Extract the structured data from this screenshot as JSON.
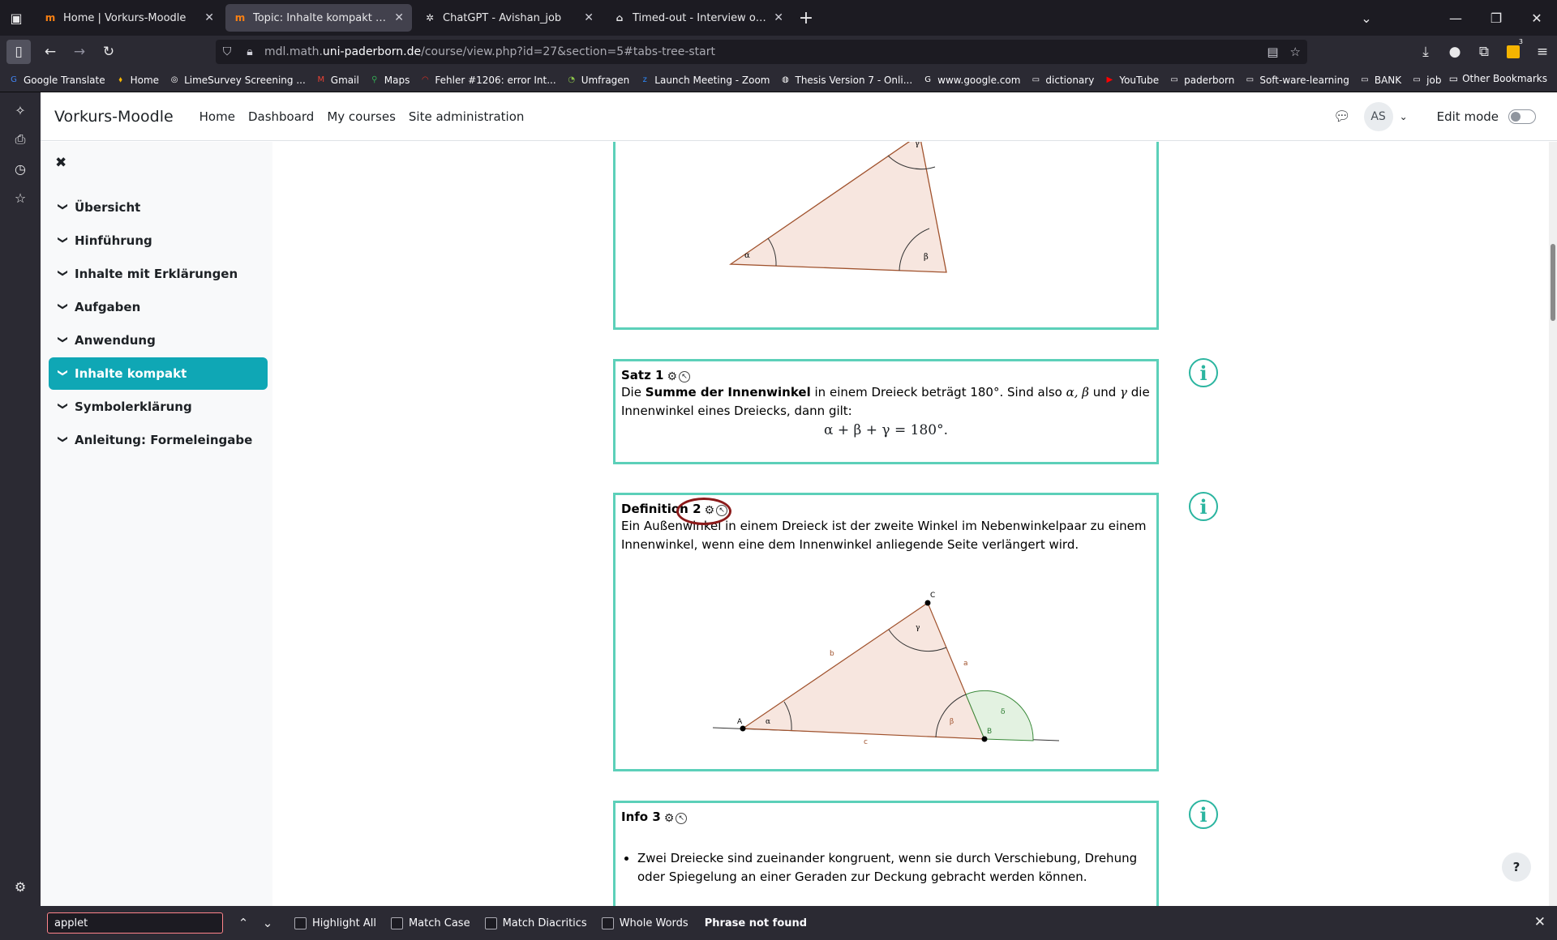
{
  "browser": {
    "tabs": [
      {
        "title": "Home | Vorkurs-Moodle",
        "favicon": "moodle-icon",
        "favicon_text": "m",
        "active": false
      },
      {
        "title": "Topic: Inhalte kompakt | Dreieck",
        "favicon": "moodle-icon",
        "favicon_text": "m",
        "active": true
      },
      {
        "title": "ChatGPT - Avishan_job",
        "favicon": "chatgpt-icon",
        "favicon_text": "✲",
        "active": false
      },
      {
        "title": "Timed-out - Interview on Passw",
        "favicon": "limesurvey-icon",
        "favicon_text": "⌂",
        "active": false
      }
    ],
    "url_prefix": "mdl.math.",
    "url_domain": "uni-paderborn.de",
    "url_path": "/course/view.php?id=27&section=5#tabs-tree-start",
    "bookmarks": [
      {
        "label": "Google Translate",
        "icon": "google-translate-icon",
        "glyph": "G",
        "color": "#4285f4"
      },
      {
        "label": "Home",
        "icon": "home-icon",
        "glyph": "⬧",
        "color": "#f5b400"
      },
      {
        "label": "LimeSurvey Screening ...",
        "icon": "limesurvey-icon",
        "glyph": "◎",
        "color": "#ffffff"
      },
      {
        "label": "Gmail",
        "icon": "gmail-icon",
        "glyph": "M",
        "color": "#ea4335"
      },
      {
        "label": "Maps",
        "icon": "maps-icon",
        "glyph": "⚲",
        "color": "#34a853"
      },
      {
        "label": "Fehler #1206: error Int...",
        "icon": "error-icon",
        "glyph": "◠",
        "color": "#d93025"
      },
      {
        "label": "Umfragen",
        "icon": "survey-icon",
        "glyph": "◔",
        "color": "#8bc34a"
      },
      {
        "label": "Launch Meeting - Zoom",
        "icon": "zoom-icon",
        "glyph": "z",
        "color": "#2d8cff"
      },
      {
        "label": "Thesis Version 7 - Onli...",
        "icon": "overleaf-icon",
        "glyph": "◍",
        "color": "#ffffff"
      },
      {
        "label": "www.google.com",
        "icon": "google-icon",
        "glyph": "G",
        "color": "#ffffff"
      },
      {
        "label": "dictionary",
        "icon": "folder-icon",
        "glyph": "▭",
        "color": "#fbfbfe"
      },
      {
        "label": "YouTube",
        "icon": "youtube-icon",
        "glyph": "▶",
        "color": "#ff0000"
      },
      {
        "label": "paderborn",
        "icon": "folder-icon",
        "glyph": "▭",
        "color": "#fbfbfe"
      },
      {
        "label": "Soft-ware-learning",
        "icon": "folder-icon",
        "glyph": "▭",
        "color": "#fbfbfe"
      },
      {
        "label": "BANK",
        "icon": "folder-icon",
        "glyph": "▭",
        "color": "#fbfbfe"
      },
      {
        "label": "job",
        "icon": "folder-icon",
        "glyph": "▭",
        "color": "#fbfbfe"
      }
    ],
    "other_bookmarks": "Other Bookmarks",
    "extension_badge": "3"
  },
  "moodle": {
    "site_name": "Vorkurs-Moodle",
    "nav": [
      "Home",
      "Dashboard",
      "My courses",
      "Site administration"
    ],
    "user_initials": "AS",
    "edit_mode_label": "Edit mode",
    "course_index": [
      {
        "label": "Übersicht",
        "active": false
      },
      {
        "label": "Hinführung",
        "active": false
      },
      {
        "label": "Inhalte mit Erklärungen",
        "active": false
      },
      {
        "label": "Aufgaben",
        "active": false
      },
      {
        "label": "Anwendung",
        "active": false
      },
      {
        "label": "Inhalte kompakt",
        "active": true
      },
      {
        "label": "Symbolerklärung",
        "active": false
      },
      {
        "label": "Anleitung: Formeleingabe",
        "active": false
      }
    ],
    "accent_color": "#0fa7b5",
    "box_border_color": "#5cd0b9"
  },
  "content": {
    "figure1_labels": {
      "alpha": "α",
      "beta": "β",
      "gamma": "γ"
    },
    "satz": {
      "title": "Satz 1",
      "text_pre": "Die ",
      "text_bold": "Summe der Innenwinkel",
      "text_mid": " in einem Dreieck beträgt 180°. Sind also ",
      "text_vars": "α, β",
      "text_und": " und ",
      "text_gamma": "γ",
      "text_post": " die Innenwinkel eines Dreiecks, dann gilt:",
      "formula": "α + β + γ = 180°."
    },
    "definition": {
      "title": "Definition 2",
      "text": "Ein Außenwinkel in einem Dreieck ist der zweite Winkel im Nebenwinkelpaar zu einem Innenwinkel, wenn eine dem Innenwinkel anliegende Seite verlängert wird."
    },
    "figure2_labels": {
      "A": "A",
      "B": "B",
      "C": "C",
      "a": "a",
      "b": "b",
      "c": "c",
      "alpha": "α",
      "beta": "β",
      "gamma": "γ",
      "delta": "δ"
    },
    "info": {
      "title": "Info 3",
      "bullet": "Zwei Dreiecke sind zueinander kongruent, wenn sie durch Verschiebung, Drehung oder Spiegelung an einer Geraden zur Deckung gebracht werden können."
    },
    "help_label": "?"
  },
  "findbar": {
    "query": "applet",
    "options": [
      "Highlight All",
      "Match Case",
      "Match Diacritics",
      "Whole Words"
    ],
    "status": "Phrase not found"
  }
}
